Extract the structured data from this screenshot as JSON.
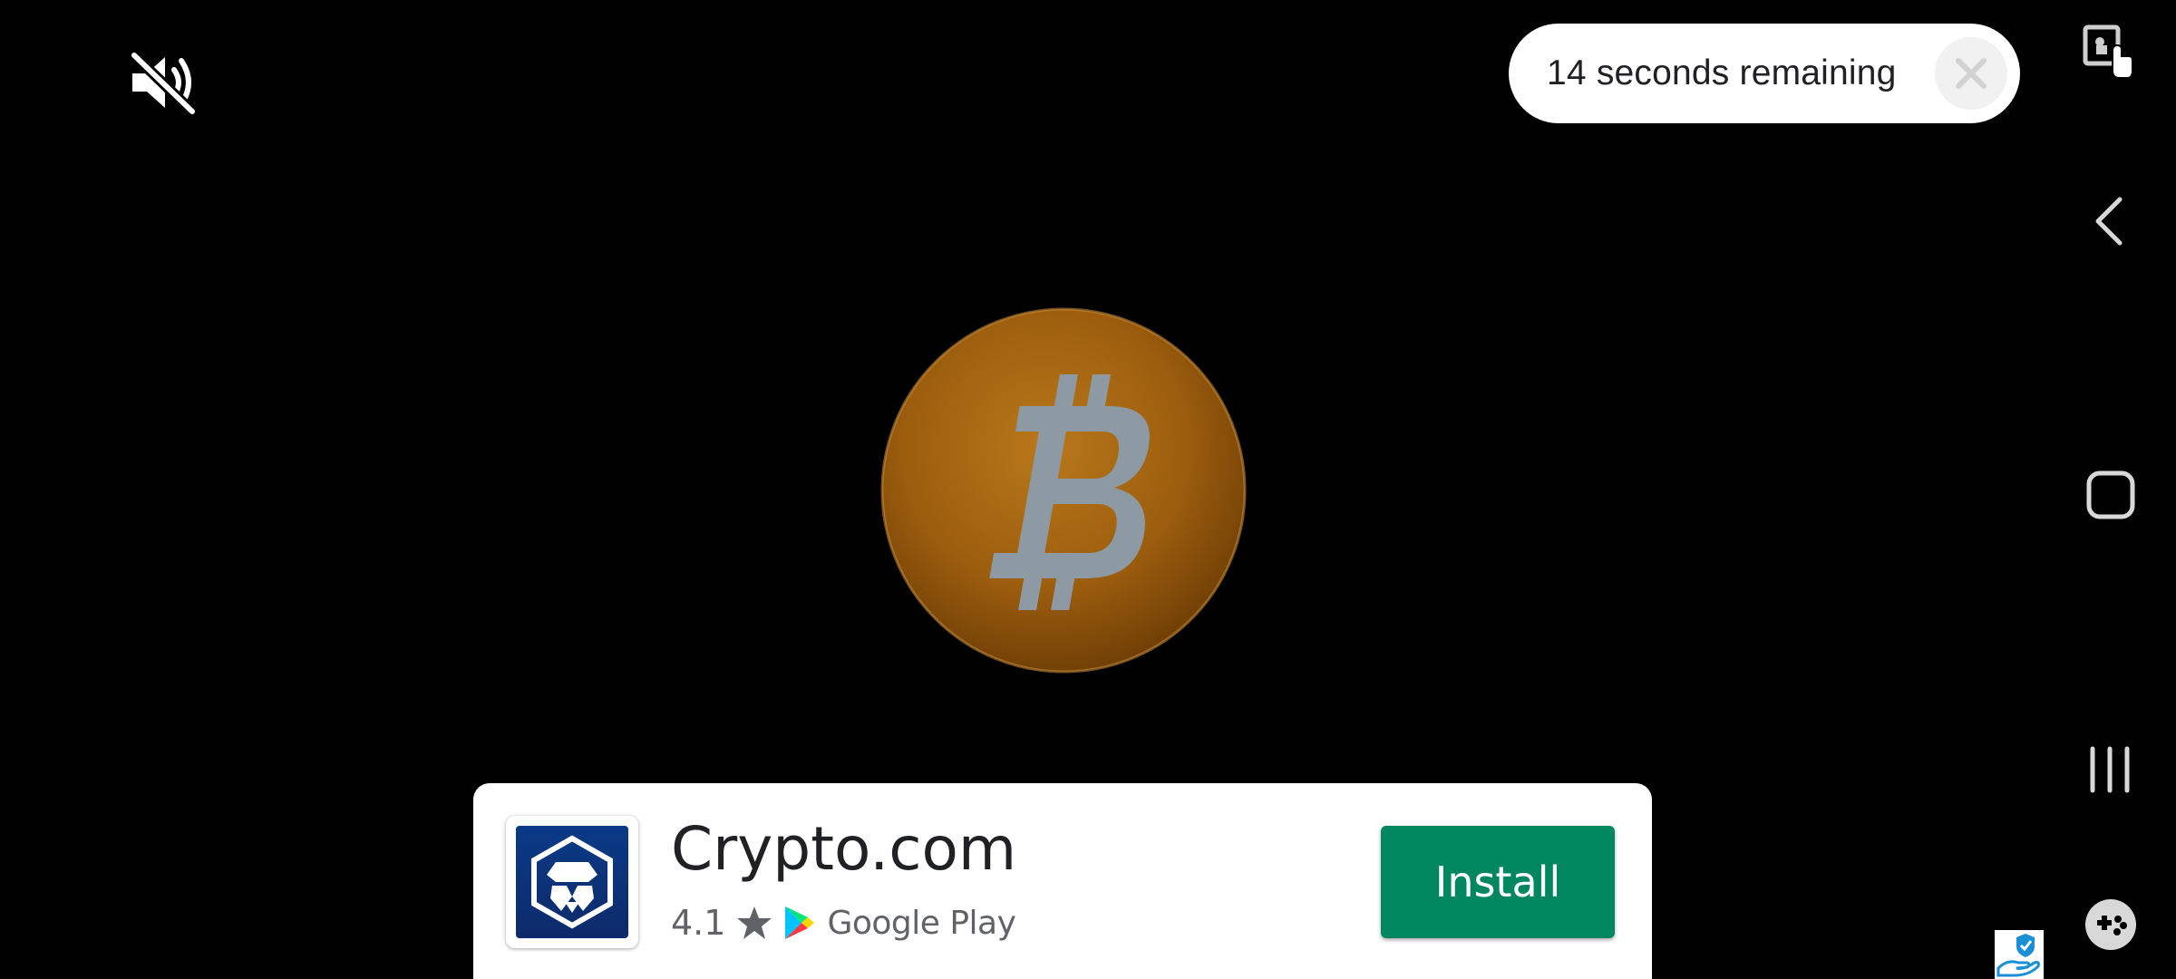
{
  "ad": {
    "countdown_text": "14 seconds remaining",
    "app_name": "Crypto.com",
    "rating": "4.1",
    "store_name": "Google Play",
    "install_label": "Install"
  },
  "icons": {
    "mute": "volume-muted-icon",
    "close": "close-icon",
    "coin": "bitcoin-coin",
    "star": "star-icon",
    "play_store": "google-play-icon",
    "app_logo": "crypto-com-lion-icon",
    "nav_back": "back-arrow-icon",
    "nav_home": "home-square-icon",
    "nav_recents": "recents-icon",
    "game_tools": "gamepad-icon",
    "screen_lock": "touch-lock-icon",
    "privacy": "shield-hand-icon"
  },
  "colors": {
    "background": "#000000",
    "install_green": "#01875f",
    "coin_gold": "#a8650d",
    "app_blue": "#0d2a6b"
  }
}
